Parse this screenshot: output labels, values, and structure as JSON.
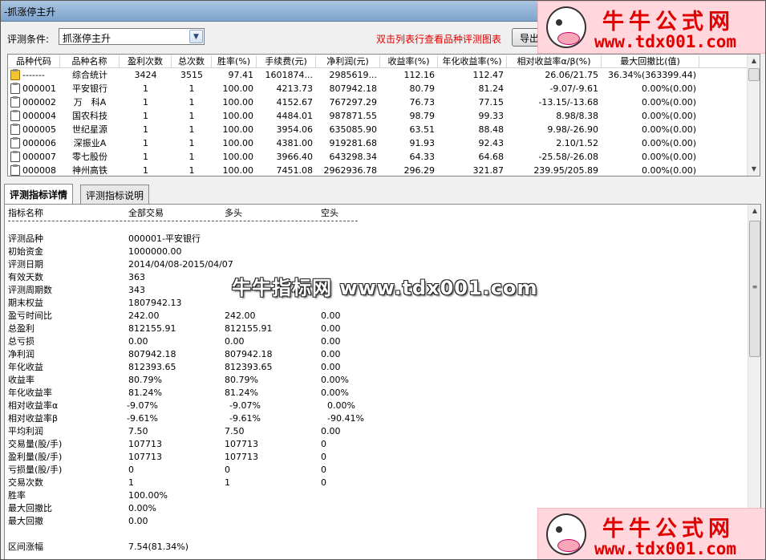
{
  "window": {
    "title": "-抓涨停主升"
  },
  "toolbar": {
    "condition_label": "评测条件:",
    "condition_value": "抓涨停主升",
    "hint": "双击列表行查看品种评测图表",
    "export_label": "导出"
  },
  "table": {
    "headers": [
      "品种代码",
      "品种名称",
      "盈利次数",
      "总次数",
      "胜率(%)",
      "手续费(元)",
      "净利润(元)",
      "收益率(%)",
      "年化收益率(%)",
      "相对收益率α/β(%)",
      "最大回撤比(值)"
    ],
    "rows": [
      [
        "-------",
        "综合统计",
        "3424",
        "3515",
        "97.41",
        "1601874...",
        "2985619...",
        "112.16",
        "112.47",
        "26.06/21.75",
        "36.34%(363399.44)"
      ],
      [
        "000001",
        "平安银行",
        "1",
        "1",
        "100.00",
        "4213.73",
        "807942.18",
        "80.79",
        "81.24",
        "-9.07/-9.61",
        "0.00%(0.00)"
      ],
      [
        "000002",
        "万　科A",
        "1",
        "1",
        "100.00",
        "4152.67",
        "767297.29",
        "76.73",
        "77.15",
        "-13.15/-13.68",
        "0.00%(0.00)"
      ],
      [
        "000004",
        "国农科技",
        "1",
        "1",
        "100.00",
        "4484.01",
        "987871.55",
        "98.79",
        "99.33",
        "8.98/8.38",
        "0.00%(0.00)"
      ],
      [
        "000005",
        "世纪星源",
        "1",
        "1",
        "100.00",
        "3954.06",
        "635085.90",
        "63.51",
        "88.48",
        "9.98/-26.90",
        "0.00%(0.00)"
      ],
      [
        "000006",
        "深振业A",
        "1",
        "1",
        "100.00",
        "4381.00",
        "919281.68",
        "91.93",
        "92.43",
        "2.10/1.52",
        "0.00%(0.00)"
      ],
      [
        "000007",
        "零七股份",
        "1",
        "1",
        "100.00",
        "3966.40",
        "643298.34",
        "64.33",
        "64.68",
        "-25.58/-26.08",
        "0.00%(0.00)"
      ],
      [
        "000008",
        "神州高铁",
        "1",
        "1",
        "100.00",
        "7451.08",
        "2962936.78",
        "296.29",
        "321.87",
        "239.95/205.89",
        "0.00%(0.00)"
      ]
    ]
  },
  "tabs": [
    "评测指标详情",
    "评测指标说明"
  ],
  "detail": {
    "header": [
      "指标名称",
      "全部交易",
      "多头",
      "空头"
    ],
    "rows": [
      [
        "评测品种",
        "000001-平安银行",
        "",
        ""
      ],
      [
        "初始资金",
        "1000000.00",
        "",
        ""
      ],
      [
        "评测日期",
        "2014/04/08-2015/04/07",
        "",
        ""
      ],
      [
        "有效天数",
        "363",
        "",
        ""
      ],
      [
        "评测周期数",
        "343",
        "",
        ""
      ],
      [
        "期末权益",
        "1807942.13",
        "",
        ""
      ],
      [
        "盈亏时间比",
        "242.00",
        "242.00",
        "0.00"
      ],
      [
        "总盈利",
        "812155.91",
        "812155.91",
        "0.00"
      ],
      [
        "总亏损",
        "0.00",
        "0.00",
        "0.00"
      ],
      [
        "净利润",
        "807942.18",
        "807942.18",
        "0.00"
      ],
      [
        "年化收益",
        "812393.65",
        "812393.65",
        "0.00"
      ],
      [
        "收益率",
        "80.79%",
        "80.79%",
        "0.00%"
      ],
      [
        "年化收益率",
        "81.24%",
        "81.24%",
        "0.00%"
      ],
      [
        "相对收益率α",
        "-9.07%",
        "-9.07%",
        "0.00%"
      ],
      [
        "相对收益率β",
        "-9.61%",
        "-9.61%",
        "-90.41%"
      ],
      [
        "平均利润",
        "7.50",
        "7.50",
        "0.00"
      ],
      [
        "交易量(股/手)",
        "107713",
        "107713",
        "0"
      ],
      [
        "盈利量(股/手)",
        "107713",
        "107713",
        "0"
      ],
      [
        "亏损量(股/手)",
        "0",
        "0",
        "0"
      ],
      [
        "交易次数",
        "1",
        "1",
        "0"
      ],
      [
        "胜率",
        "100.00%",
        "",
        ""
      ],
      [
        "最大回撤比",
        "0.00%",
        "",
        ""
      ],
      [
        "最大回撤",
        "0.00",
        "",
        ""
      ],
      [
        "",
        "",
        " ",
        ""
      ],
      [
        "区间涨幅",
        "7.54(81.34%)",
        "",
        ""
      ]
    ]
  },
  "watermark": {
    "brand": "牛牛公式网",
    "url": "www.tdx001.com",
    "center_text": "牛牛指标网 www.tdx001.com"
  },
  "colors": {
    "hint": "#e00000",
    "watermark_bg": "#ffd7dc",
    "watermark_text": "#e00000"
  }
}
